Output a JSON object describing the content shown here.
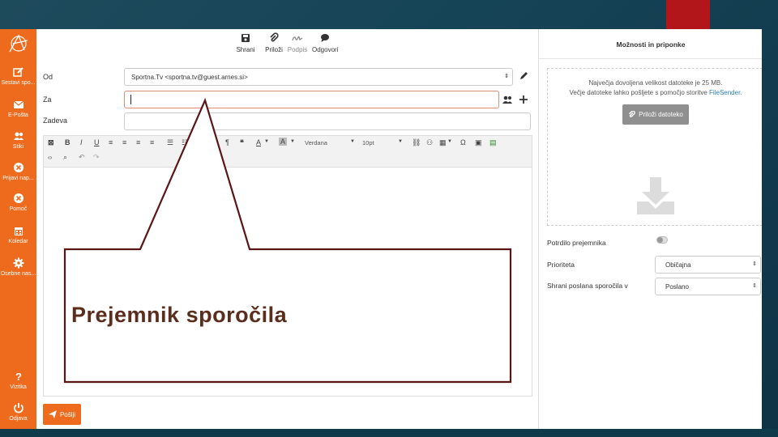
{
  "sidebar": {
    "items": [
      {
        "label": "Sestavi spo...",
        "icon": "edit-icon"
      },
      {
        "label": "E-Pošta",
        "icon": "envelope-icon"
      },
      {
        "label": "Stiki",
        "icon": "contacts-icon"
      },
      {
        "label": "Prijavi nap...",
        "icon": "x-circle-icon"
      },
      {
        "label": "Pomoč",
        "icon": "x-circle-icon"
      },
      {
        "label": "Koledar",
        "icon": "calendar-icon"
      },
      {
        "label": "Osebne nas...",
        "icon": "gear-icon"
      },
      {
        "label": "Vizitka",
        "icon": "question-icon"
      },
      {
        "label": "Odjava",
        "icon": "power-icon"
      }
    ]
  },
  "toolbar": {
    "save": "Shrani",
    "attach": "Priloži",
    "signature": "Podpis",
    "reply": "Odgovori"
  },
  "form": {
    "from_label": "Od",
    "from_value": "Sportna.Tv <sportna.tv@guest.arnes.si>",
    "to_label": "Za",
    "subject_label": "Zadeva"
  },
  "editor": {
    "font": "Verdana",
    "size": "10pt"
  },
  "send_label": "Pošlji",
  "panel": {
    "title": "Možnosti in priponke",
    "max_size_text": "Največja dovoljena velikost datoteke je 25 MB.",
    "large_files_text": "Večje datoteke lahko pošljete s pomočjo storitve",
    "filesender": "FileSender.",
    "attach_button": "Priloži datoteko",
    "receipt_label": "Potrdilo prejemnika",
    "priority_label": "Prioriteta",
    "priority_value": "Običajna",
    "save_sent_label": "Shrani poslana sporočila v",
    "save_sent_value": "Poslano"
  },
  "callout": {
    "text": "Prejemnik sporočila"
  },
  "colors": {
    "sidebar": "#ee6a1c",
    "accent_red": "#b3161a",
    "callout_border": "#5a1616"
  }
}
